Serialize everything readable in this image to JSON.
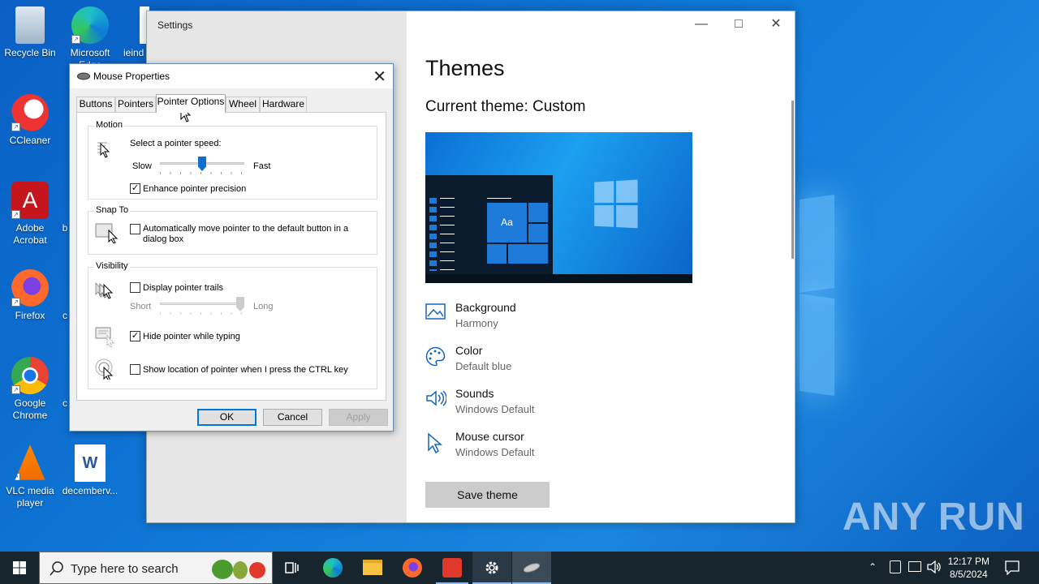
{
  "desktop": {
    "icons": [
      {
        "label": "Recycle Bin"
      },
      {
        "label": "Microsoft Edge"
      },
      {
        "label": "ieind"
      },
      {
        "label": "CCleaner"
      },
      {
        "label": "Adobe Acrobat"
      },
      {
        "label": "b"
      },
      {
        "label": "Firefox"
      },
      {
        "label": "c"
      },
      {
        "label": "Google Chrome"
      },
      {
        "label": "c"
      },
      {
        "label": "VLC media player"
      },
      {
        "label": "decemberv..."
      }
    ],
    "watermark": "ANY RUN"
  },
  "settings": {
    "window_title": "Settings",
    "heading": "Themes",
    "current_theme": "Current theme: Custom",
    "preview_tile": "Aa",
    "items": [
      {
        "title": "Background",
        "value": "Harmony",
        "icon": "picture-icon"
      },
      {
        "title": "Color",
        "value": "Default blue",
        "icon": "palette-icon"
      },
      {
        "title": "Sounds",
        "value": "Windows Default",
        "icon": "speaker-icon"
      },
      {
        "title": "Mouse cursor",
        "value": "Windows Default",
        "icon": "cursor-icon"
      }
    ],
    "save_button": "Save theme"
  },
  "mouse_dialog": {
    "title": "Mouse Properties",
    "tabs": [
      "Buttons",
      "Pointers",
      "Pointer Options",
      "Wheel",
      "Hardware"
    ],
    "active_tab": "Pointer Options",
    "motion": {
      "group": "Motion",
      "speed_label": "Select a pointer speed:",
      "slow": "Slow",
      "fast": "Fast",
      "speed_level": 0.5,
      "precision_label": "Enhance pointer precision",
      "precision_checked": true
    },
    "snap": {
      "group": "Snap To",
      "label_line1": "Automatically move pointer to the default button in a",
      "label_line2": "dialog box",
      "checked": false
    },
    "visibility": {
      "group": "Visibility",
      "trails_label": "Display pointer trails",
      "trails_checked": false,
      "short": "Short",
      "long": "Long",
      "trail_level": 1.0,
      "hide_label": "Hide pointer while typing",
      "hide_checked": true,
      "ctrl_label": "Show location of pointer when I press the CTRL key",
      "ctrl_checked": false
    },
    "buttons": {
      "ok": "OK",
      "cancel": "Cancel",
      "apply": "Apply"
    }
  },
  "taskbar": {
    "search_placeholder": "Type here to search",
    "time": "12:17 PM",
    "date": "8/5/2024"
  }
}
